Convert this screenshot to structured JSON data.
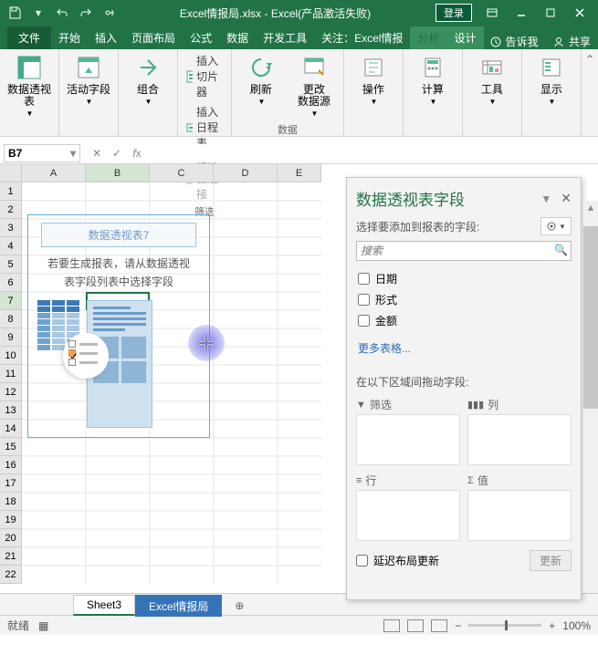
{
  "title": "Excel情报局.xlsx - Excel(产品激活失败)",
  "login": "登录",
  "tabs": {
    "file": "文件",
    "home": "开始",
    "insert": "插入",
    "layout": "页面布局",
    "formula": "公式",
    "data": "数据",
    "dev": "开发工具",
    "attn": "关注：Excel情报",
    "analyze": "分析",
    "design": "设计",
    "tellme": "告诉我",
    "share": "共享"
  },
  "ribbon": {
    "pivottable": "数据透视\n表",
    "activefield": "活动字段",
    "group": "组合",
    "slicer": "插入切片器",
    "timeline": "插入日程表",
    "filterconn": "筛选器连接",
    "filter_grp": "筛选",
    "refresh": "刷新",
    "changesrc": "更改\n数据源",
    "data_grp": "数据",
    "actions": "操作",
    "calc": "计算",
    "tools": "工具",
    "show": "显示"
  },
  "namebox": "B7",
  "columns": [
    "A",
    "B",
    "C",
    "D",
    "E"
  ],
  "rows": [
    "1",
    "2",
    "3",
    "4",
    "5",
    "6",
    "7",
    "8",
    "9",
    "10",
    "11",
    "12",
    "13",
    "14",
    "15",
    "16",
    "17",
    "18",
    "19",
    "20",
    "21",
    "22"
  ],
  "pivot": {
    "title": "数据透视表7",
    "line1": "若要生成报表，请从数据透视",
    "line2": "表字段列表中选择字段"
  },
  "fieldpane": {
    "title": "数据透视表字段",
    "subtitle": "选择要添加到报表的字段:",
    "search": "搜索",
    "fields": [
      "日期",
      "形式",
      "金额"
    ],
    "more": "更多表格...",
    "dragtext": "在以下区域间拖动字段:",
    "filters": "筛选",
    "columns": "列",
    "rows": "行",
    "values": "值",
    "defer": "延迟布局更新",
    "update": "更新"
  },
  "sheets": {
    "s1": "Sheet3",
    "s2": "Excel情报局"
  },
  "status": {
    "ready": "就绪",
    "zoom": "100%"
  }
}
